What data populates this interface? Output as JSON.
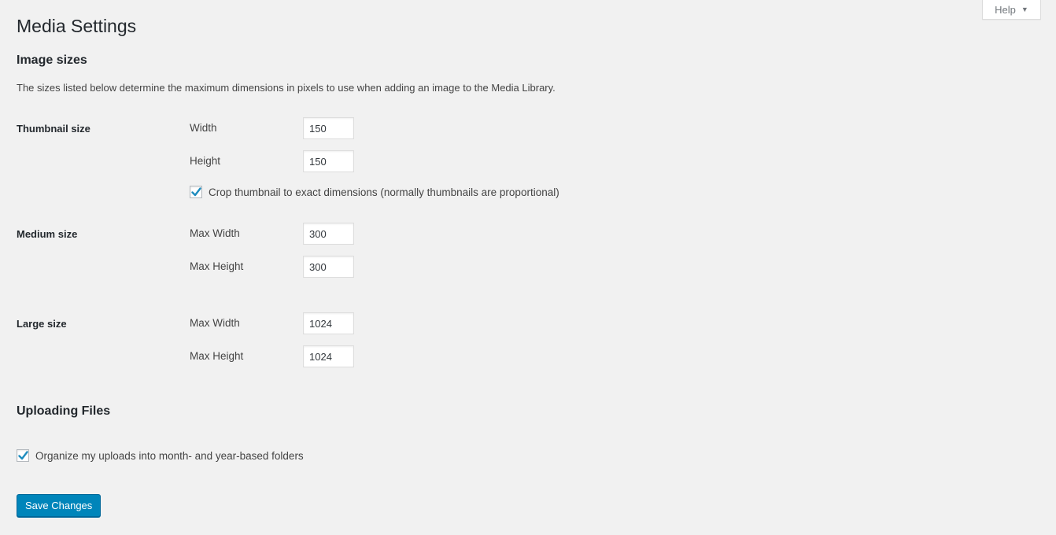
{
  "header": {
    "title": "Media Settings",
    "help_label": "Help",
    "help_icon": "caret-down-icon"
  },
  "image_sizes": {
    "title": "Image sizes",
    "description": "The sizes listed below determine the maximum dimensions in pixels to use when adding an image to the Media Library.",
    "thumbnail": {
      "label": "Thumbnail size",
      "width_label": "Width",
      "width_value": "150",
      "height_label": "Height",
      "height_value": "150",
      "crop_label": "Crop thumbnail to exact dimensions (normally thumbnails are proportional)",
      "crop_checked": true
    },
    "medium": {
      "label": "Medium size",
      "width_label": "Max Width",
      "width_value": "300",
      "height_label": "Max Height",
      "height_value": "300"
    },
    "large": {
      "label": "Large size",
      "width_label": "Max Width",
      "width_value": "1024",
      "height_label": "Max Height",
      "height_value": "1024"
    }
  },
  "uploading": {
    "title": "Uploading Files",
    "organize_label": "Organize my uploads into month- and year-based folders",
    "organize_checked": true
  },
  "actions": {
    "save_label": "Save Changes"
  },
  "colors": {
    "accent": "#0085ba",
    "checkmark": "#1e8cbe",
    "background": "#f1f1f1"
  }
}
